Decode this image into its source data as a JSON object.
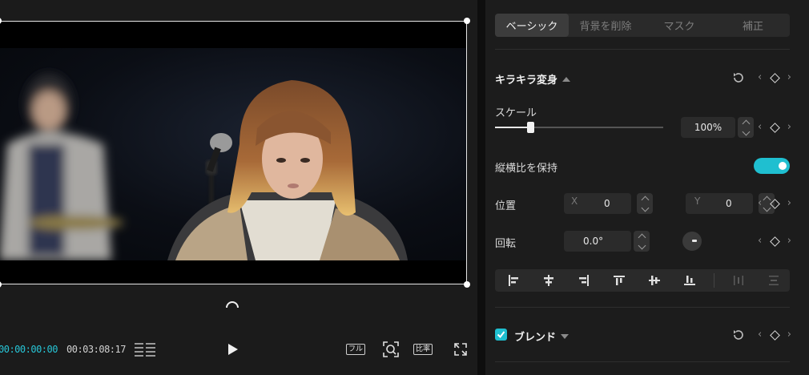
{
  "preview": {
    "timecode_current": "00:00:00:00",
    "timecode_total": "00:03:08:17",
    "fullscreen_label": "フル",
    "ratio_label": "比率"
  },
  "inspector": {
    "tabs": [
      {
        "label": "ベーシック",
        "active": true
      },
      {
        "label": "背景を削除",
        "active": false
      },
      {
        "label": "マスク",
        "active": false
      },
      {
        "label": "補正",
        "active": false
      }
    ],
    "transform": {
      "title": "キラキラ変身",
      "scale_label": "スケール",
      "scale_value": "100%",
      "scale_slider_fraction": 0.21,
      "keep_ratio_label": "縦横比を保持",
      "keep_ratio_on": true,
      "position_label": "位置",
      "x_label": "X",
      "x_value": "0",
      "y_label": "Y",
      "y_value": "0",
      "rotation_label": "回転",
      "rotation_value": "0.0°"
    },
    "blend": {
      "title": "ブレンド",
      "checked": true
    }
  },
  "colors": {
    "accent": "#1fbfd0",
    "panel": "#1c1c1c",
    "field": "#2b2b2b"
  }
}
